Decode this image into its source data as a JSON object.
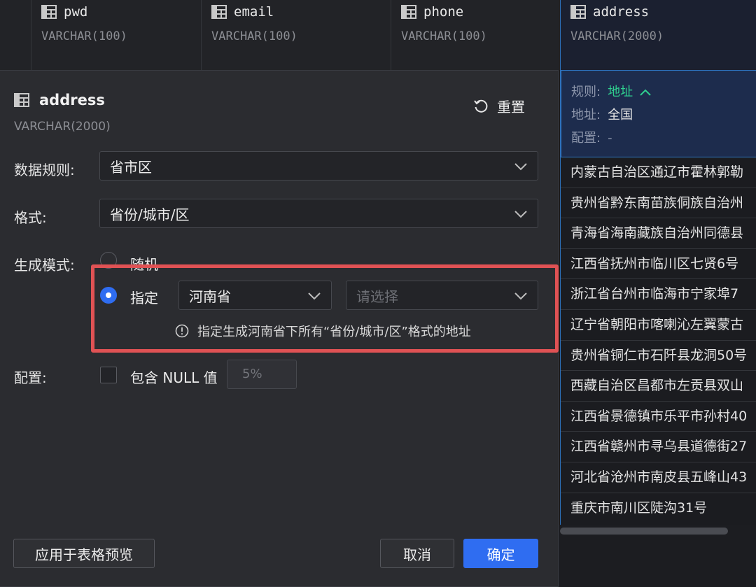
{
  "columns": [
    {
      "name": "pwd",
      "type": "VARCHAR(100)"
    },
    {
      "name": "email",
      "type": "VARCHAR(100)"
    },
    {
      "name": "phone",
      "type": "VARCHAR(100)"
    },
    {
      "name": "address",
      "type": "VARCHAR(2000)"
    }
  ],
  "preview": {
    "rule_label": "规则:",
    "rule_value": "地址",
    "region_label": "地址:",
    "region_value": "全国",
    "config_label": "配置:",
    "config_value": "-",
    "items": [
      "内蒙古自治区通辽市霍林郭勒",
      "贵州省黔东南苗族侗族自治州",
      "青海省海南藏族自治州同德县",
      "江西省抚州市临川区七贤6号",
      "浙江省台州市临海市宁家埠7",
      "辽宁省朝阳市喀喇沁左翼蒙古",
      "贵州省铜仁市石阡县龙洞50号",
      "西藏自治区昌都市左贡县双山",
      "江西省景德镇市乐平市孙村40",
      "江西省赣州市寻乌县道德街27",
      "河北省沧州市南皮县五峰山43",
      "重庆市南川区陡沟31号"
    ]
  },
  "dialog": {
    "title": "address",
    "subtitle": "VARCHAR(2000)",
    "reset_label": "重置",
    "data_rule": {
      "label": "数据规则:",
      "value": "省市区"
    },
    "format": {
      "label": "格式:",
      "value": "省份/城市/区"
    },
    "mode": {
      "label": "生成模式:",
      "random_label": "随机",
      "specify_label": "指定",
      "province_value": "河南省",
      "city_placeholder": "请选择",
      "selected": "specify"
    },
    "hint": "指定生成河南省下所有“省份/城市/区”格式的地址",
    "config": {
      "label": "配置:",
      "null_label": "包含 NULL 值",
      "null_percent": "5%",
      "null_checked": false
    },
    "buttons": {
      "apply": "应用于表格预览",
      "cancel": "取消",
      "ok": "确定"
    }
  },
  "colors": {
    "accent": "#2f6df1",
    "highlight": "#e05254",
    "rule_value": "#2fcf8f"
  }
}
